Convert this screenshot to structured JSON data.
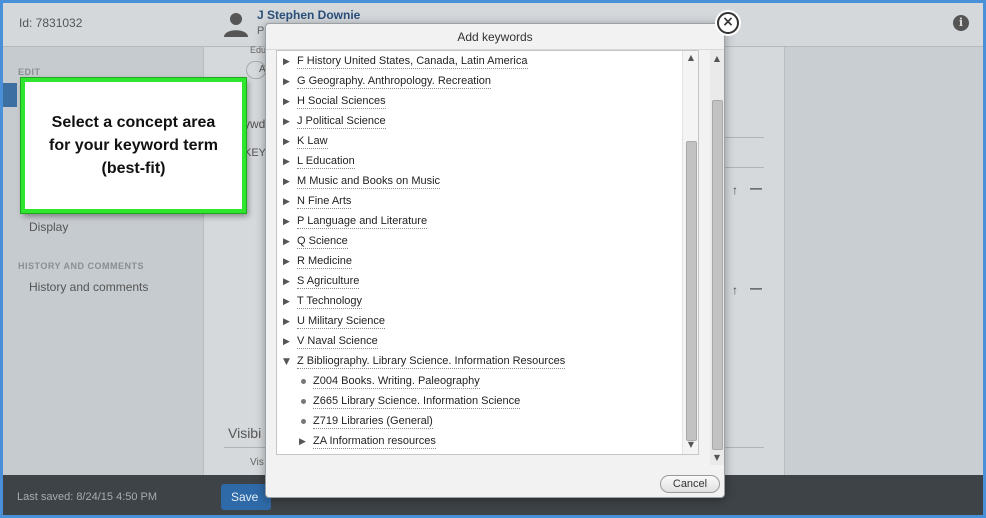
{
  "header": {
    "id_label": "Id: 7831032",
    "person_name": "J Stephen Downie",
    "person_sub": "P"
  },
  "sidebar": {
    "edit_heading": "EDIT",
    "display_label": "Display",
    "history_heading": "HISTORY AND COMMENTS",
    "history_label": "History and comments"
  },
  "content": {
    "edu_fragment": "Edu",
    "a_button": "A",
    "ywd_fragment": "ywd",
    "key_fragment": "KEY",
    "visibility_fragment": "Visibi",
    "vis_fragment": "Vis"
  },
  "footer": {
    "last_saved": "Last saved: 8/24/15 4:50 PM",
    "save_label": "Save"
  },
  "callout": {
    "text": "Select a concept area\nfor your keyword term\n(best-fit)",
    "border_color": "#2ee62e"
  },
  "modal": {
    "title": "Add keywords",
    "cancel_label": "Cancel",
    "items": [
      {
        "label": "F History United States, Canada, Latin America",
        "kind": "collapsed",
        "level": 0
      },
      {
        "label": "G Geography. Anthropology. Recreation",
        "kind": "collapsed",
        "level": 0
      },
      {
        "label": "H Social Sciences",
        "kind": "collapsed",
        "level": 0
      },
      {
        "label": "J Political Science",
        "kind": "collapsed",
        "level": 0
      },
      {
        "label": "K Law",
        "kind": "collapsed",
        "level": 0
      },
      {
        "label": "L Education",
        "kind": "collapsed",
        "level": 0
      },
      {
        "label": "M Music and Books on Music",
        "kind": "collapsed",
        "level": 0
      },
      {
        "label": "N Fine Arts",
        "kind": "collapsed",
        "level": 0
      },
      {
        "label": "P Language and Literature",
        "kind": "collapsed",
        "level": 0
      },
      {
        "label": "Q Science",
        "kind": "collapsed",
        "level": 0
      },
      {
        "label": "R Medicine",
        "kind": "collapsed",
        "level": 0
      },
      {
        "label": "S Agriculture",
        "kind": "collapsed",
        "level": 0
      },
      {
        "label": "T Technology",
        "kind": "collapsed",
        "level": 0
      },
      {
        "label": "U Military Science",
        "kind": "collapsed",
        "level": 0
      },
      {
        "label": "V Naval Science",
        "kind": "collapsed",
        "level": 0
      },
      {
        "label": "Z Bibliography. Library Science. Information Resources",
        "kind": "expanded",
        "level": 0
      },
      {
        "label": "Z004 Books. Writing. Paleography",
        "kind": "leaf",
        "level": 1
      },
      {
        "label": "Z665 Library Science. Information Science",
        "kind": "leaf",
        "level": 1
      },
      {
        "label": "Z719 Libraries (General)",
        "kind": "leaf",
        "level": 1
      },
      {
        "label": "ZA Information resources",
        "kind": "collapsed",
        "level": 1
      }
    ]
  },
  "icons": {
    "close": "close-icon",
    "info": "info-icon",
    "person": "person-icon",
    "collapsed_arrow": "triangle-right-icon",
    "expanded_arrow": "triangle-down-icon",
    "leaf_bullet": "bullet-icon"
  }
}
